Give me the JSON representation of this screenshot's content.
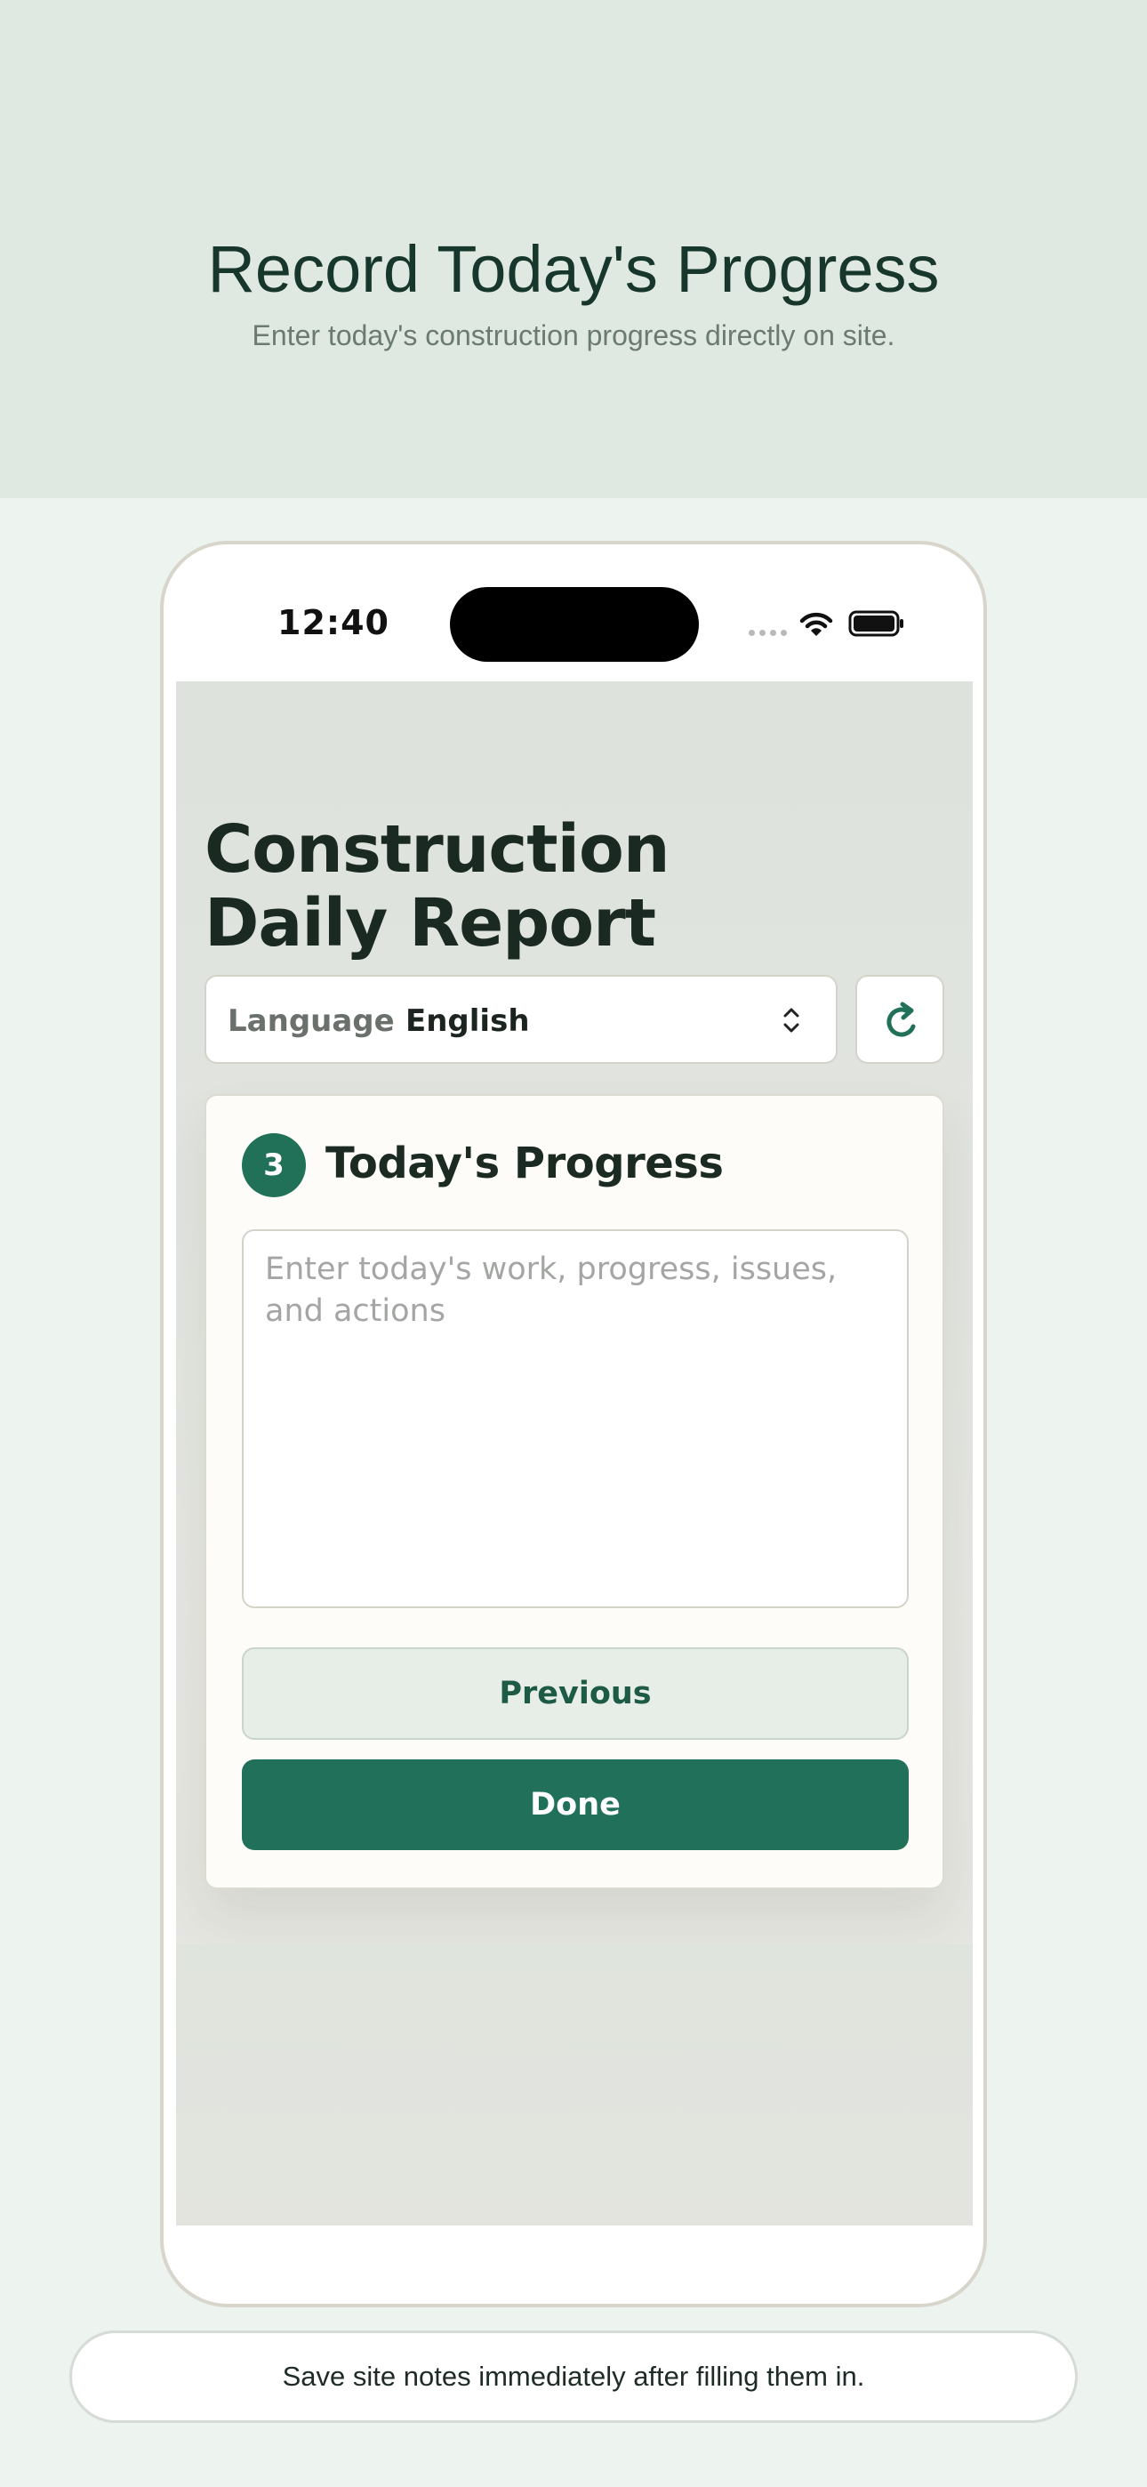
{
  "hero": {
    "title": "Record Today's Progress",
    "subtitle": "Enter today's construction progress directly on site."
  },
  "status_bar": {
    "time": "12:40",
    "icons": [
      "signal-dots-icon",
      "wifi-icon",
      "battery-icon"
    ]
  },
  "app": {
    "title_line1": "Construction",
    "title_line2": "Daily Report",
    "language": {
      "label": "Language",
      "value": "English"
    },
    "refresh_icon": "refresh-icon",
    "step": {
      "number": "3",
      "title": "Today's Progress",
      "textarea_placeholder": "Enter today's work, progress, issues, and actions",
      "textarea_value": ""
    },
    "buttons": {
      "previous": "Previous",
      "done": "Done"
    }
  },
  "footer_note": "Save site notes immediately after filling them in.",
  "colors": {
    "accent": "#20705a",
    "hero_bg": "#dfe8e1",
    "page_bg": "#edf3ee"
  }
}
